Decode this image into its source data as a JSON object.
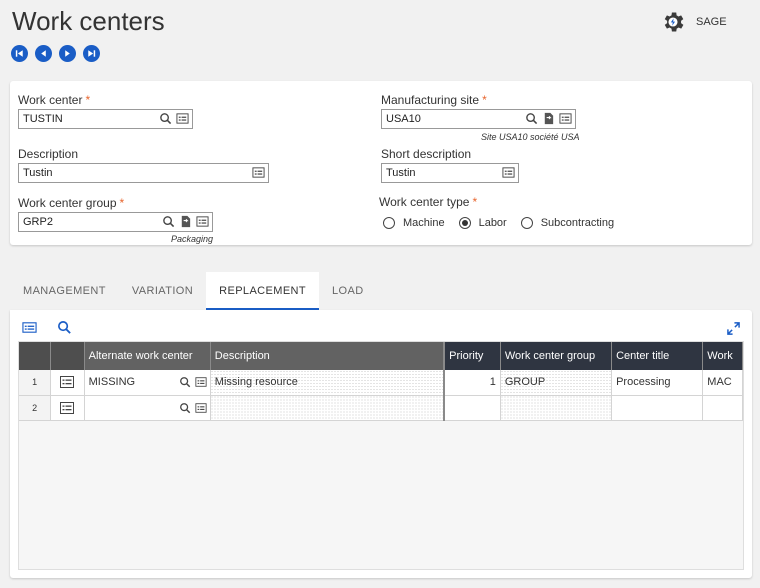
{
  "page": {
    "title": "Work centers"
  },
  "user": {
    "name": "SAGE"
  },
  "form": {
    "work_center": {
      "label": "Work center",
      "value": "TUSTIN"
    },
    "manufacturing_site": {
      "label": "Manufacturing site",
      "value": "USA10",
      "hint": "Site USA10 société USA"
    },
    "description": {
      "label": "Description",
      "value": "Tustin"
    },
    "short_description": {
      "label": "Short description",
      "value": "Tustin"
    },
    "work_center_group": {
      "label": "Work center group",
      "value": "GRP2",
      "hint": "Packaging"
    },
    "work_center_type": {
      "label": "Work center type",
      "options": [
        "Machine",
        "Labor",
        "Subcontracting"
      ],
      "selected": "Labor"
    }
  },
  "tabs": [
    {
      "label": "MANAGEMENT",
      "active": false
    },
    {
      "label": "VARIATION",
      "active": false
    },
    {
      "label": "REPLACEMENT",
      "active": true
    },
    {
      "label": "LOAD",
      "active": false
    }
  ],
  "grid": {
    "columns": [
      "Alternate work center",
      "Description",
      "Priority",
      "Work center group",
      "Center title",
      "Work"
    ],
    "rows": [
      {
        "num": "1",
        "alternate": "MISSING",
        "description": "Missing resource",
        "priority": "1",
        "group": "GROUP",
        "title": "Processing",
        "work": "MAC"
      },
      {
        "num": "2",
        "alternate": "",
        "description": "",
        "priority": "",
        "group": "",
        "title": "",
        "work": ""
      }
    ]
  },
  "colors": {
    "accent": "#1a5dc6",
    "required": "#e8652d",
    "header": "#626262"
  }
}
